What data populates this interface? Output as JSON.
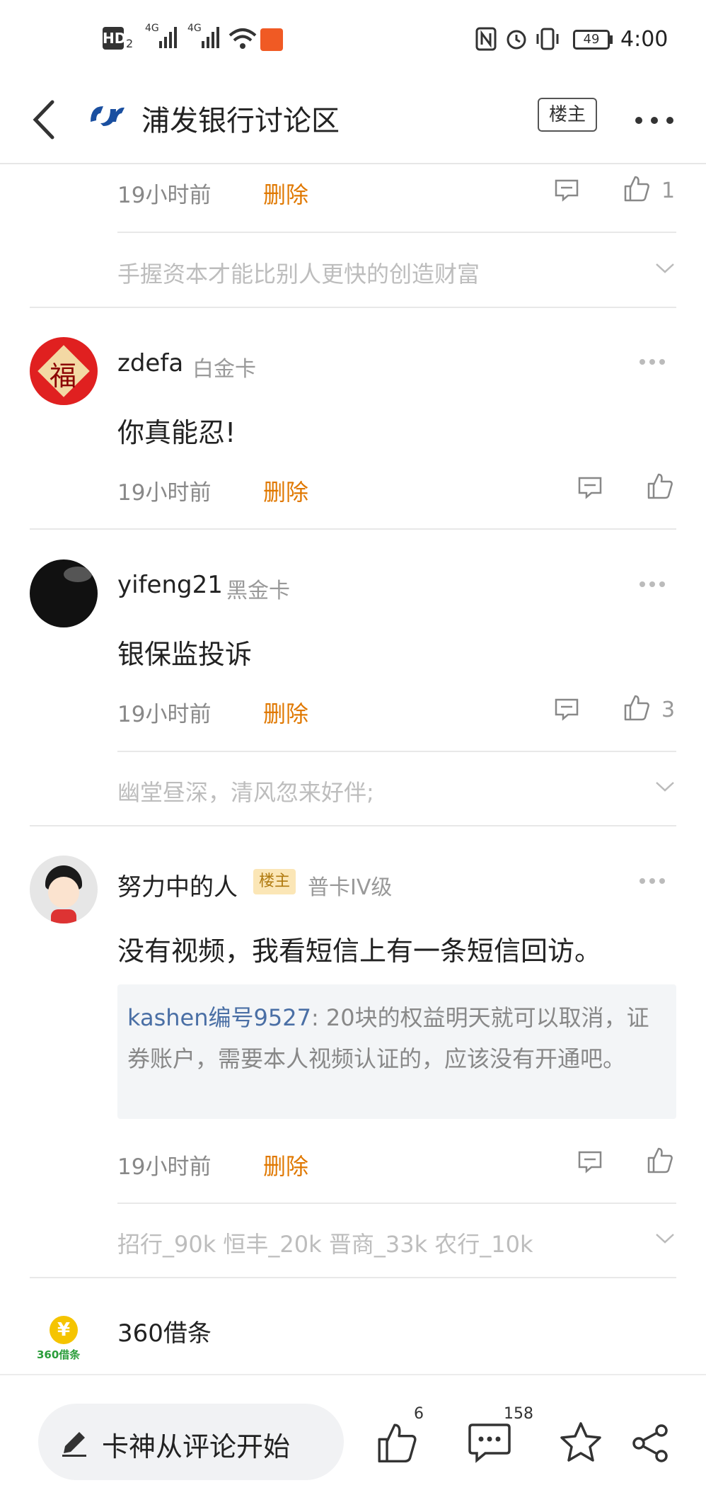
{
  "status_bar": {
    "left_label": "HD",
    "network_1": "4G",
    "network_2": "4G",
    "battery_level": "49",
    "time": "4:00"
  },
  "header": {
    "title": "浦发银行讨论区",
    "owner_button": "楼主"
  },
  "thread": {
    "reply_top": {
      "time": "19小时前",
      "delete_label": "删除",
      "like_count": "1",
      "signature": "手握资本才能比别人更快的创造财富"
    },
    "comments": [
      {
        "username": "zdefa",
        "badge": "白金卡",
        "body": "你真能忍!",
        "time": "19小时前",
        "delete_label": "删除",
        "like_count": "",
        "avatar_text": "福"
      },
      {
        "username": "yifeng21",
        "badge": "黑金卡",
        "body": "银保监投诉",
        "time": "19小时前",
        "delete_label": "删除",
        "like_count": "3",
        "signature": "幽堂昼深，清风忽来好伴;"
      },
      {
        "username": "努力中的人",
        "owner_tag": "楼主",
        "badge": "普卡IV级",
        "body": "没有视频，我看短信上有一条短信回访。",
        "quote_name": "kashen编号9527",
        "quote_text": ": 20块的权益明天就可以取消，证券账户，需要本人视频认证的，应该没有开通吧。",
        "time": "19小时前",
        "delete_label": "删除",
        "signature": "招行_90k   恒丰_20k   晋商_33k   农行_10k"
      }
    ],
    "ad": {
      "title": "360借条",
      "logo_text": "360借条"
    }
  },
  "bottom_bar": {
    "input_placeholder": "卡神从评论开始",
    "like_count": "6",
    "comment_count": "158"
  },
  "colors": {
    "accent_orange": "#e07800",
    "quote_blue": "#4a6fa5",
    "brand_blue": "#1a4fa0"
  }
}
